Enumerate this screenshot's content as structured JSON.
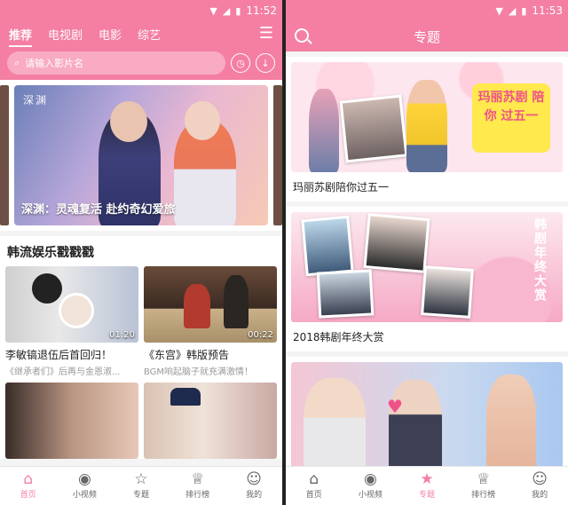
{
  "left": {
    "status_time": "11:52",
    "tabs": [
      {
        "label": "推荐"
      },
      {
        "label": "电视剧"
      },
      {
        "label": "电影"
      },
      {
        "label": "综艺"
      }
    ],
    "search_placeholder": "请输入影片名",
    "banner": {
      "tag": "深渊",
      "caption": "深渊：灵魂复活 赴约奇幻爱旅"
    },
    "section_title": "韩流娱乐戳戳戳",
    "videos": [
      {
        "title": "李敏镐退伍后首回归！",
        "subtitle": "《继承者们》后再与金恩淑...",
        "duration": "01:20"
      },
      {
        "title": "《东宫》韩版预告",
        "subtitle": "BGM响起脑子就充满激情！",
        "duration": "00:22"
      },
      {
        "title": "",
        "subtitle": "",
        "duration": ""
      },
      {
        "title": "",
        "subtitle": "",
        "duration": ""
      }
    ]
  },
  "right": {
    "status_time": "11:53",
    "title": "专题",
    "topics": [
      {
        "title": "玛丽苏剧陪你过五一",
        "overlay": "玛丽苏剧 陪你 过五一"
      },
      {
        "title": "2018韩剧年终大赏",
        "overlay": "韩剧年终大赏"
      },
      {
        "title": "",
        "overlay": ""
      }
    ]
  },
  "bottom_nav": [
    {
      "label": "首页",
      "icon": "home-icon"
    },
    {
      "label": "小视频",
      "icon": "eye-icon"
    },
    {
      "label": "专题",
      "icon": "star-icon"
    },
    {
      "label": "排行榜",
      "icon": "trophy-icon"
    },
    {
      "label": "我的",
      "icon": "person-icon"
    }
  ],
  "colors": {
    "accent": "#f47fa3"
  }
}
